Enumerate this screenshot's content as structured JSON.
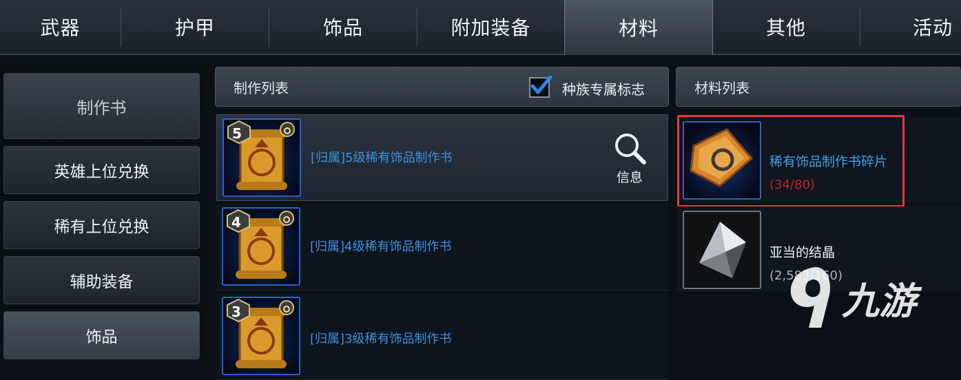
{
  "tabs": [
    {
      "label": "武器"
    },
    {
      "label": "护甲"
    },
    {
      "label": "饰品"
    },
    {
      "label": "附加装备"
    },
    {
      "label": "材料",
      "active": true
    },
    {
      "label": "其他"
    },
    {
      "label": "活动"
    }
  ],
  "sidebar": {
    "header": "制作书",
    "items": [
      {
        "label": "英雄上位兑换"
      },
      {
        "label": "稀有上位兑换"
      },
      {
        "label": "辅助装备"
      },
      {
        "label": "饰品",
        "selected": true
      }
    ]
  },
  "craft_panel": {
    "title": "制作列表",
    "race_filter_label": "种族专属标志",
    "race_filter_checked": true,
    "info_label": "信息",
    "rows": [
      {
        "level": "5",
        "label": "[归属]5级稀有饰品制作书",
        "selected": true
      },
      {
        "level": "4",
        "label": "[归属]4级稀有饰品制作书"
      },
      {
        "level": "3",
        "label": "[归属]3级稀有饰品制作书"
      }
    ]
  },
  "material_panel": {
    "title": "材料列表",
    "items": [
      {
        "name": "稀有饰品制作书碎片",
        "count": "(34/80)",
        "name_color": "#3fa0ea",
        "count_color": "#c2262c"
      },
      {
        "name": "亚当的结晶",
        "count": "(2,583/160)",
        "name_color": "#eef1f4",
        "count_color": "#aab2ba"
      }
    ]
  },
  "watermark": {
    "text": "九游"
  },
  "colors": {
    "accent_blue": "#2f5fd0",
    "highlight_red": "#e4383f",
    "link_blue": "#3f8fe0"
  }
}
